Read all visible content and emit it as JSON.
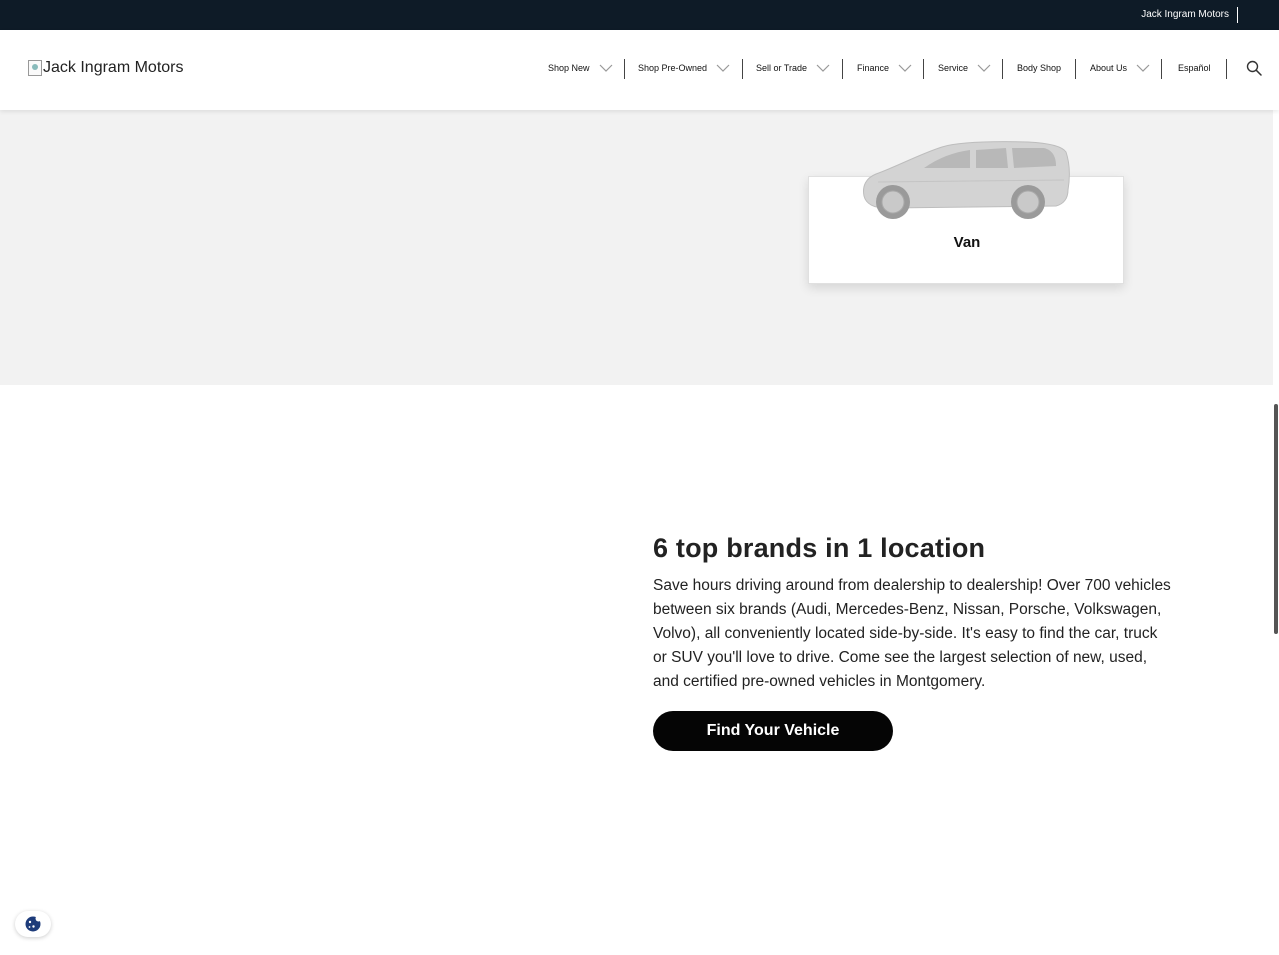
{
  "topbar": {
    "dealer_name": "Jack Ingram Motors"
  },
  "header": {
    "logo_alt": "Jack Ingram Motors",
    "nav": [
      {
        "label": "Shop New",
        "has_dropdown": true
      },
      {
        "label": "Shop Pre-Owned",
        "has_dropdown": true
      },
      {
        "label": "Sell or Trade",
        "has_dropdown": true
      },
      {
        "label": "Finance",
        "has_dropdown": true
      },
      {
        "label": "Service",
        "has_dropdown": true
      },
      {
        "label": "Body Shop",
        "has_dropdown": false
      },
      {
        "label": "About Us",
        "has_dropdown": true
      },
      {
        "label": "Español",
        "has_dropdown": false
      }
    ],
    "search_icon": "search-icon"
  },
  "vehicle_types": {
    "card_label": "Van",
    "image_icon": "van-silhouette"
  },
  "info": {
    "heading": "6 top brands in 1 location",
    "body": "Save hours driving around from dealership to dealership! Over 700 vehicles between six brands (Audi, Mercedes-Benz, Nissan, Porsche, Volkswagen, Volvo), all conveniently located side-by-side. It's easy to find the car, truck or SUV you'll love to drive. Come see the largest selection of new, used, and certified pre-owned vehicles in Montgomery.",
    "cta_label": "Find Your Vehicle"
  },
  "cookie": {
    "icon": "cookie-icon",
    "color": "#1d3b7a"
  },
  "colors": {
    "topbar_bg": "#0e1b27",
    "section_bg": "#f2f2f2",
    "cta_bg": "#050505"
  }
}
